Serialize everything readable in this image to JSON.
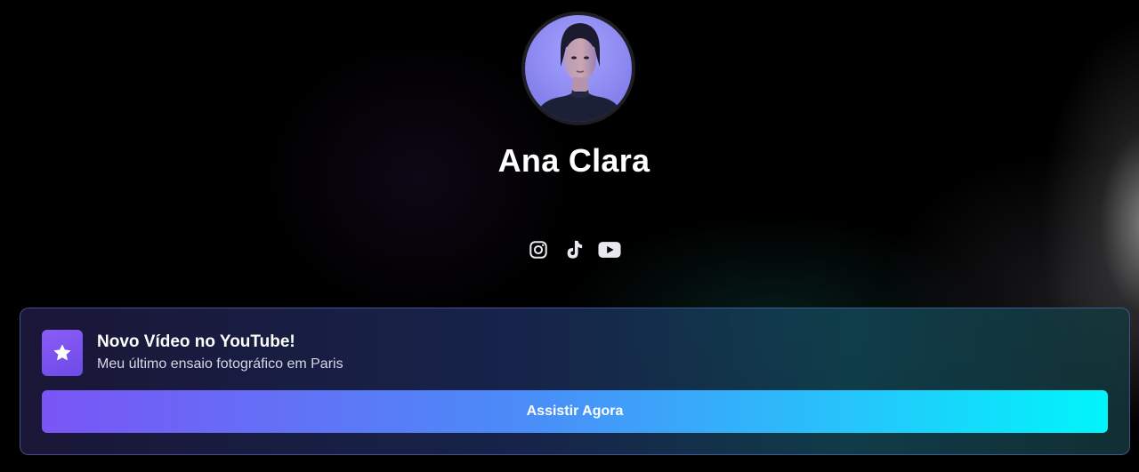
{
  "profile": {
    "name": "Ana Clara",
    "avatar_icon": "profile-photo"
  },
  "socials": [
    {
      "icon": "instagram-icon"
    },
    {
      "icon": "tiktok-icon"
    },
    {
      "icon": "youtube-icon"
    }
  ],
  "card": {
    "icon": "star-icon",
    "title": "Novo Vídeo no YouTube!",
    "subtitle": "Meu último ensaio fotográfico em Paris",
    "button_label": "Assistir Agora"
  },
  "colors": {
    "background": "#000000",
    "accent_purple": "#7a55f5",
    "accent_cyan": "#00f5fb",
    "icon_purple": "#8b5cf6"
  }
}
